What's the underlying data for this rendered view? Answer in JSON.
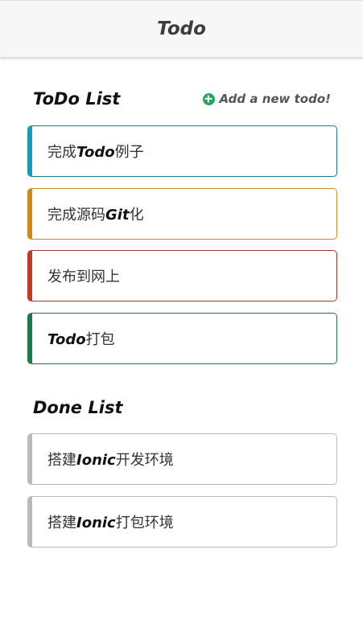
{
  "header": {
    "title": "Todo"
  },
  "todo_section": {
    "title": "ToDo List",
    "add_label": "Add a new todo!",
    "items": [
      {
        "pre": "完成",
        "em": "Todo",
        "post": "例子",
        "color": "#1a9bb5"
      },
      {
        "pre": "完成源码",
        "em": "Git",
        "post": "化",
        "color": "#cc8a1a"
      },
      {
        "pre": "发布到网上",
        "em": "",
        "post": "",
        "color": "#c0392b"
      },
      {
        "pre": "",
        "em": "Todo",
        "post": "打包",
        "color": "#1a7a4a"
      }
    ]
  },
  "done_section": {
    "title": "Done List",
    "items": [
      {
        "pre": "搭建",
        "em": "Ionic",
        "post": "开发环境",
        "color": "#bbbbbb"
      },
      {
        "pre": "搭建",
        "em": "Ionic",
        "post": "打包环境",
        "color": "#bbbbbb"
      }
    ]
  },
  "colors": {
    "header_bg": "#f7f7f7",
    "add_icon": "#22a55b"
  }
}
